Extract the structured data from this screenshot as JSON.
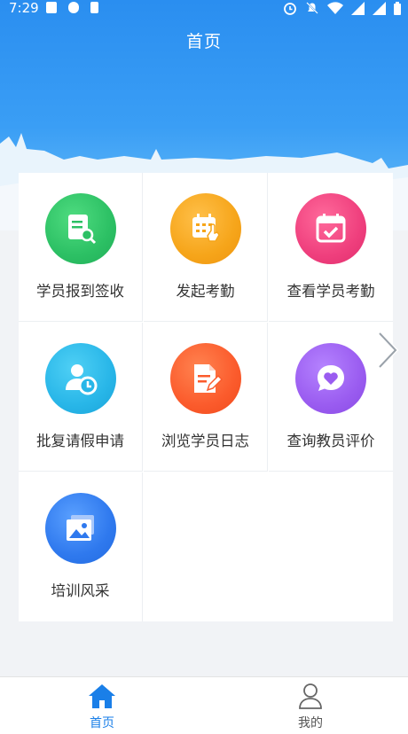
{
  "status_bar": {
    "time": "7:29"
  },
  "header": {
    "title": "首页"
  },
  "menu": {
    "items": [
      {
        "label": "学员报到签收",
        "icon": "sign-in-document-icon",
        "color": "#2cc064"
      },
      {
        "label": "发起考勤",
        "icon": "calendar-tap-icon",
        "color": "#f6a51a"
      },
      {
        "label": "查看学员考勤",
        "icon": "calendar-check-icon",
        "color": "#ef3f7d"
      },
      {
        "label": "批复请假申请",
        "icon": "person-clock-icon",
        "color": "#28b6e8"
      },
      {
        "label": "浏览学员日志",
        "icon": "document-edit-icon",
        "color": "#fb5b2c"
      },
      {
        "label": "查询教员评价",
        "icon": "heart-chat-icon",
        "color": "#9a5cf0"
      },
      {
        "label": "培训风采",
        "icon": "photo-gallery-icon",
        "color": "#2f79ee"
      }
    ]
  },
  "tabbar": {
    "active_color": "#1a7fe8",
    "inactive_color": "#555555",
    "tabs": [
      {
        "label": "首页",
        "icon": "home-icon",
        "active": true
      },
      {
        "label": "我的",
        "icon": "user-icon",
        "active": false
      }
    ]
  }
}
